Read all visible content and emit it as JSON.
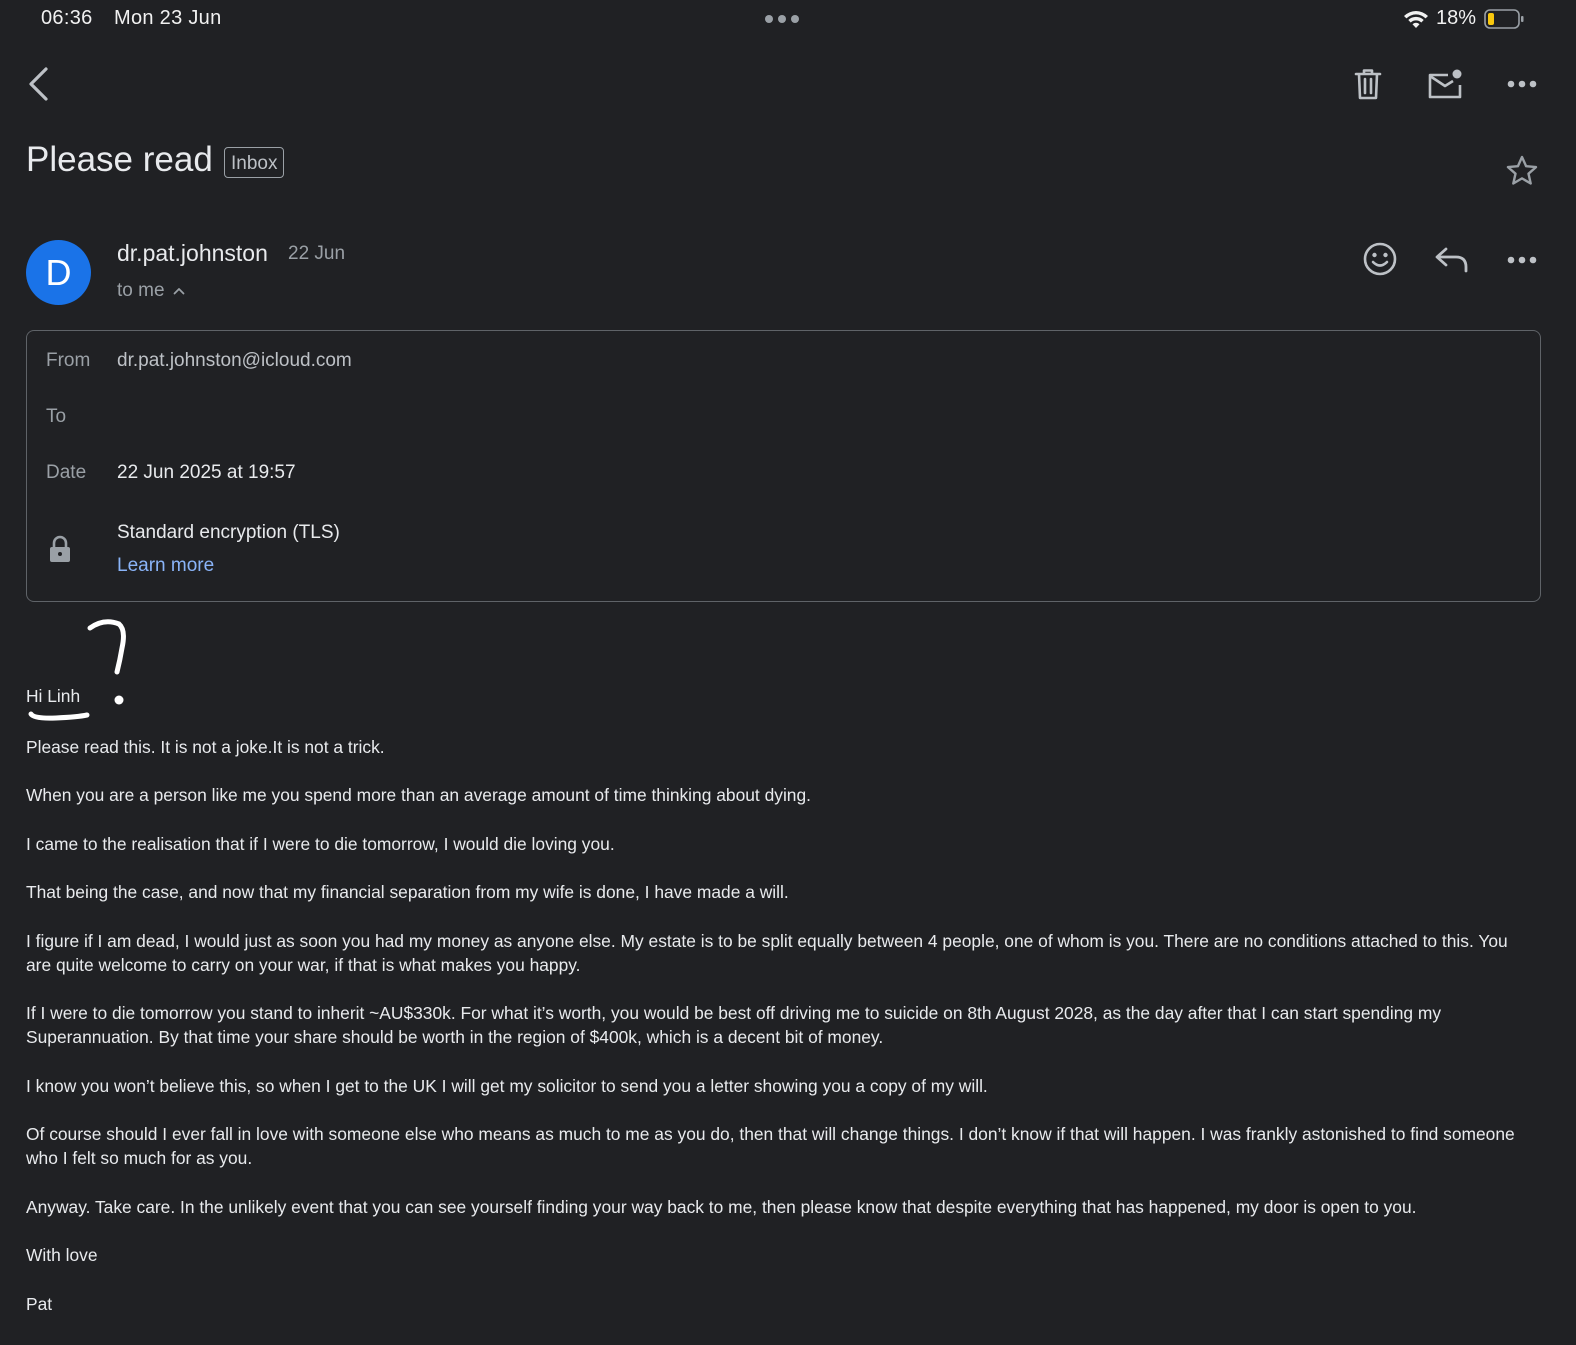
{
  "status_bar": {
    "time": "06:36",
    "date": "Mon 23 Jun",
    "battery": "18%"
  },
  "toolbar": {
    "back_icon": "chevron-left-icon",
    "delete_icon": "trash-icon",
    "mark_unread_icon": "mail-unread-icon",
    "more_icon": "more-horizontal-icon"
  },
  "email": {
    "subject": "Please read",
    "label": "Inbox",
    "sender": {
      "avatar_letter": "D",
      "avatar_color": "#1a73e8",
      "name": "dr.pat.johnston",
      "date": "22 Jun",
      "recipient_summary": "to me"
    },
    "details": {
      "from_label": "From",
      "from_value": "dr.pat.johnston@icloud.com",
      "to_label": "To",
      "to_value": "",
      "date_label": "Date",
      "date_value": "22 Jun 2025 at 19:57",
      "encryption": "Standard encryption (TLS)",
      "learn_more": "Learn more"
    },
    "greeting": "Hi Linh",
    "paragraphs": [
      "Please read this. It is not a joke.It is not a trick.",
      "When you are a person like me you spend more than an average amount of time thinking about dying.",
      "I came to the realisation that if I were to die tomorrow, I would die loving you.",
      "That being the case, and now that my financial separation from my wife is done, I have made a will.",
      "I figure if I am dead, I would just as soon you had my money as anyone else. My estate is to be split equally between 4 people, one of whom is you. There are no conditions attached to this. You are quite welcome to carry on your war, if that is what makes you happy.",
      "If I were to die tomorrow you stand to inherit ~AU$330k. For what it’s worth, you would be best off driving me to suicide on 8th August 2028, as the day after that I can start spending my Superannuation. By that time your share should be worth in the region of $400k, which is a decent bit of money.",
      "I know you won’t believe this, so when I get to the UK I will get my solicitor to send you a letter showing you a copy of my will.",
      "Of course should I ever fall in love with someone else who means as much to me as you do, then that will change things. I don’t know if that will happen. I was frankly astonished to find someone who I felt so much for as you.",
      "Anyway. Take care. In the unlikely event that you can see yourself finding your way back to me, then please know that despite everything that has happened, my door is open to you.",
      "With love",
      "Pat"
    ]
  },
  "colors": {
    "background": "#202124",
    "link": "#8ab4f8",
    "battery_low": "#f9c80e"
  }
}
